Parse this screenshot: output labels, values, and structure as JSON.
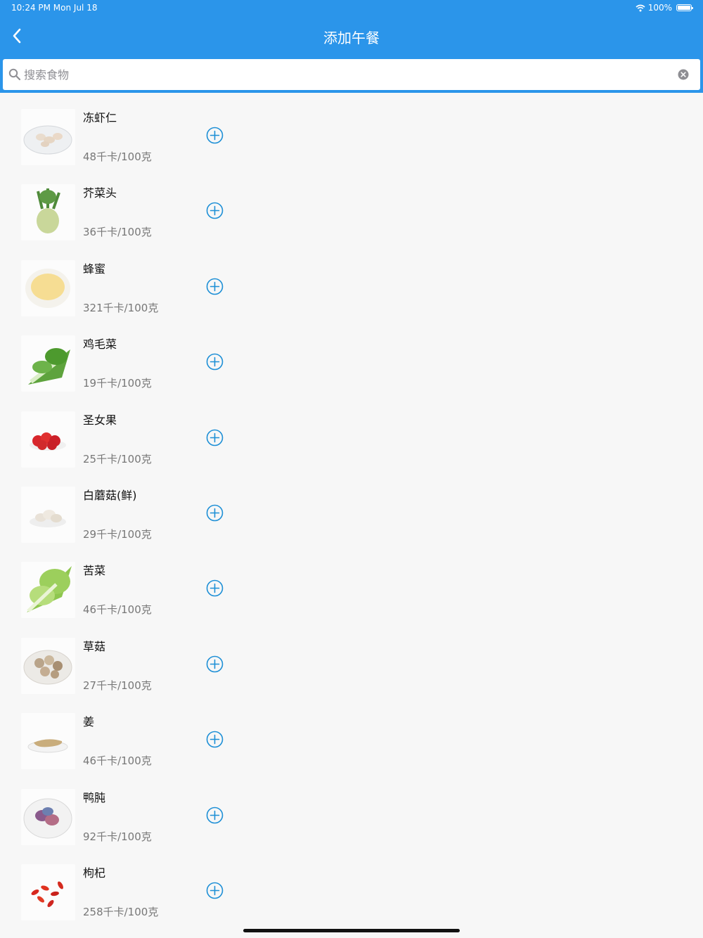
{
  "status_bar": {
    "time": "10:24 PM   Mon Jul 18",
    "battery": "100%"
  },
  "header": {
    "title": "添加午餐"
  },
  "search": {
    "placeholder": "搜索食物"
  },
  "colors": {
    "accent": "#2b95ea",
    "add_button": "#1d8fd6"
  },
  "foods": [
    {
      "name": "冻虾仁",
      "kcal": "48千卡/100克",
      "image": "shrimp"
    },
    {
      "name": "芥菜头",
      "kcal": "36千卡/100克",
      "image": "kohlrabi"
    },
    {
      "name": "蜂蜜",
      "kcal": "321千卡/100克",
      "image": "honey"
    },
    {
      "name": "鸡毛菜",
      "kcal": "19千卡/100克",
      "image": "greens"
    },
    {
      "name": "圣女果",
      "kcal": "25千卡/100克",
      "image": "cherry-tomato"
    },
    {
      "name": "白蘑菇(鲜)",
      "kcal": "29千卡/100克",
      "image": "mushroom"
    },
    {
      "name": "苦菜",
      "kcal": "46千卡/100克",
      "image": "endive"
    },
    {
      "name": "草菇",
      "kcal": "27千卡/100克",
      "image": "straw-mushroom"
    },
    {
      "name": "姜",
      "kcal": "46千卡/100克",
      "image": "ginger"
    },
    {
      "name": "鸭肫",
      "kcal": "92千卡/100克",
      "image": "duck-gizzard"
    },
    {
      "name": "枸杞",
      "kcal": "258千卡/100克",
      "image": "goji"
    }
  ]
}
